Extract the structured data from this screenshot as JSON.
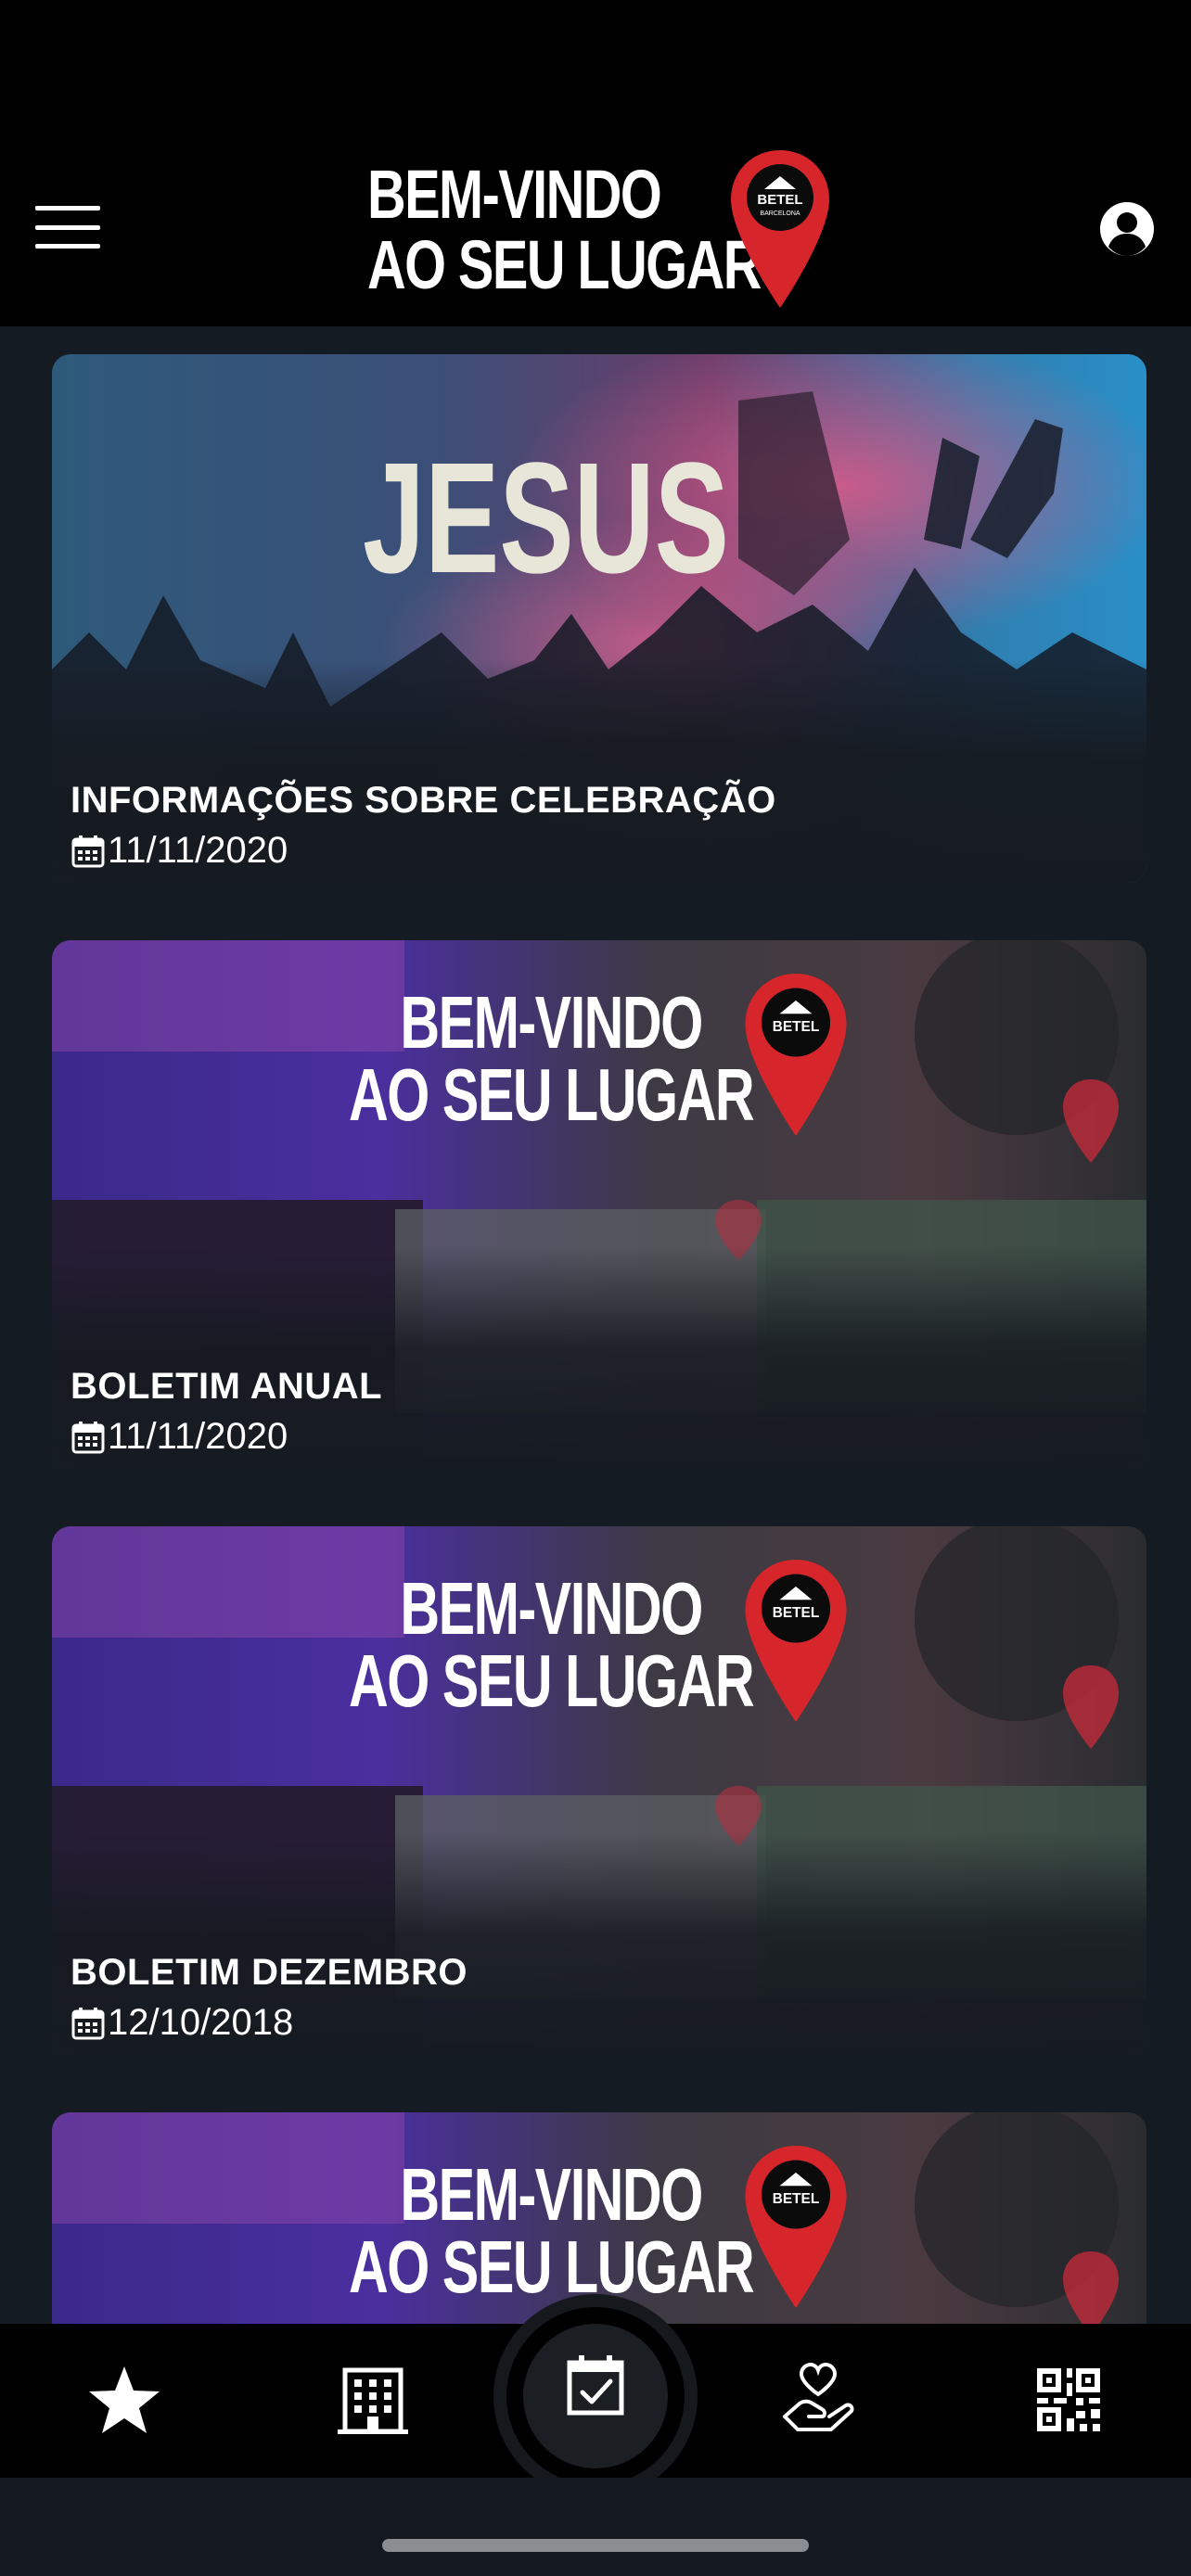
{
  "header": {
    "logo_line1": "BEM-VINDO",
    "logo_line2": "AO SEU LUGAR",
    "logo_pin_text": "BETEL",
    "logo_pin_subtext": "BARCELONA",
    "menu_icon": "hamburger-menu-icon",
    "profile_icon": "user-circle-icon"
  },
  "feed": {
    "items": [
      {
        "title": "INFORMAÇÕES SOBRE CELEBRAÇÃO",
        "date": "11/11/2020",
        "image_text": "JESUS"
      },
      {
        "title": "BOLETIM ANUAL",
        "date": "11/11/2020",
        "image_text_1": "BEM-VINDO",
        "image_text_2": "AO SEU LUGAR",
        "pin_text": "BETEL"
      },
      {
        "title": "BOLETIM DEZEMBRO",
        "date": "12/10/2018",
        "image_text_1": "BEM-VINDO",
        "image_text_2": "AO SEU LUGAR",
        "pin_text": "BETEL"
      },
      {
        "title": "",
        "date": "",
        "image_text_1": "BEM-VINDO",
        "image_text_2": "AO SEU LUGAR",
        "pin_text": "BETEL"
      }
    ]
  },
  "bottom_nav": {
    "items": [
      {
        "icon": "star-icon"
      },
      {
        "icon": "building-icon"
      },
      {
        "icon": "calendar-check-icon",
        "active": true
      },
      {
        "icon": "heart-hand-icon"
      },
      {
        "icon": "qr-code-icon"
      }
    ]
  },
  "colors": {
    "background": "#151b22",
    "header": "#000000",
    "pin_red": "#d7262b",
    "bottom_nav": "#000000"
  }
}
